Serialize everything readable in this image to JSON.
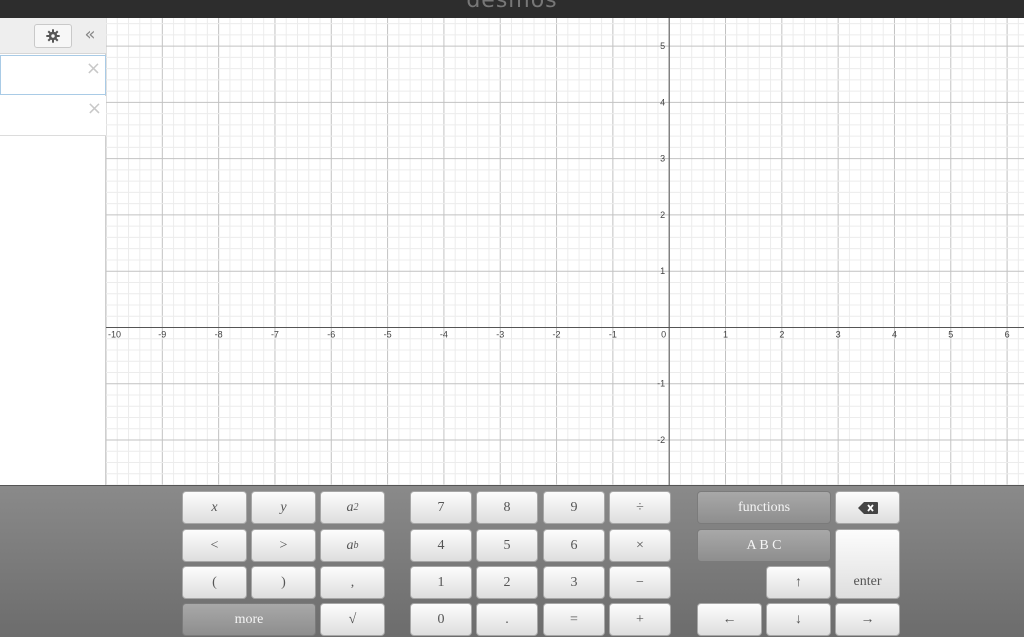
{
  "app": {
    "brand": "desmos"
  },
  "sidebar": {
    "settings_icon": "gear-icon",
    "collapse_label": "«",
    "expressions": [
      {
        "value": "",
        "delete_label": "×"
      },
      {
        "value": "",
        "delete_label": "×"
      }
    ]
  },
  "graph": {
    "x_range": [
      -10,
      6.3
    ],
    "y_range": [
      -2.8,
      5.5
    ],
    "x_ticks": [
      "-10",
      "-9",
      "-8",
      "-7",
      "-6",
      "-5",
      "-4",
      "-3",
      "-2",
      "-1",
      "0",
      "1",
      "2",
      "3",
      "4",
      "5",
      "6"
    ],
    "y_ticks": [
      "-2",
      "-1",
      "1",
      "2",
      "3",
      "4",
      "5"
    ],
    "grid": true
  },
  "keypad": {
    "group1": [
      "x",
      "y",
      "a2",
      "<",
      ">",
      "ab",
      "(",
      ")",
      ",",
      "more",
      "√"
    ],
    "group2": [
      "7",
      "8",
      "9",
      "÷",
      "4",
      "5",
      "6",
      "×",
      "1",
      "2",
      "3",
      "−",
      "0",
      ".",
      "=",
      "+"
    ],
    "functions": "functions",
    "abc": "A B C",
    "backspace_icon": "backspace-icon",
    "up": "↑",
    "enter": "enter",
    "left": "←",
    "down": "↓",
    "right": "→"
  }
}
